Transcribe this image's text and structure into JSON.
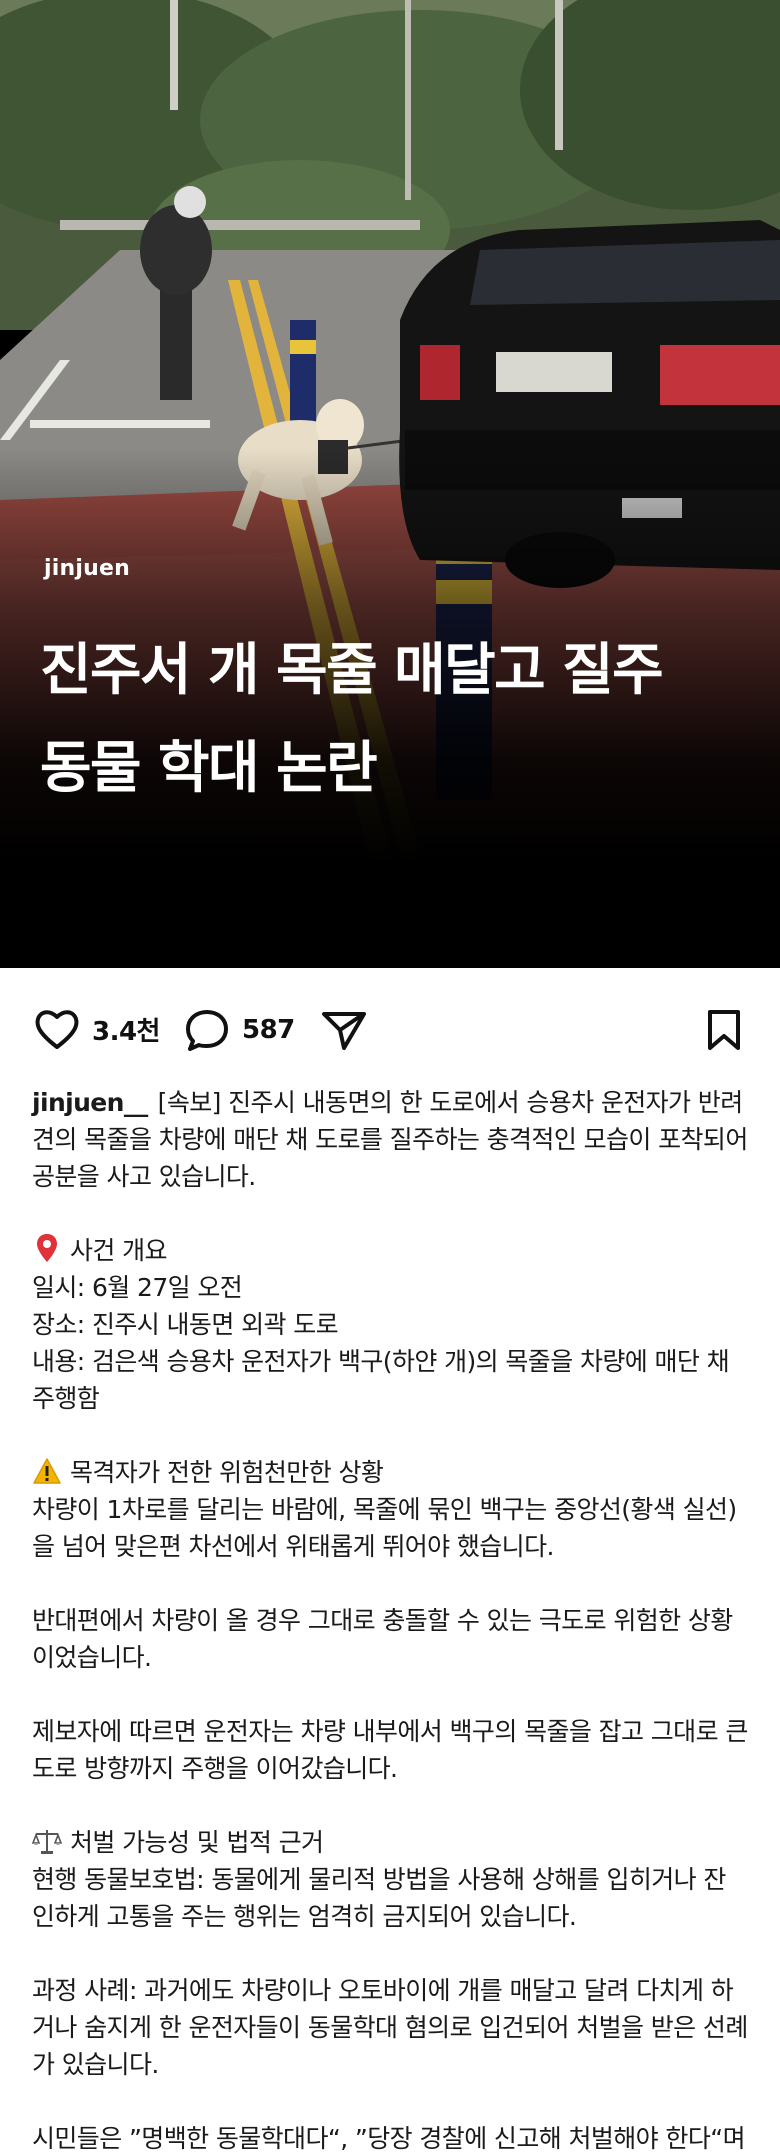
{
  "image": {
    "watermark": "jinjuen",
    "headline_lines": [
      "진주서 개 목줄 매달고 질주",
      "동물 학대 논란"
    ]
  },
  "actions": {
    "likes": "3.4천",
    "comments": "587",
    "icons": [
      "heart-icon",
      "comment-icon",
      "send-icon",
      "bookmark-icon"
    ]
  },
  "post": {
    "username": "jinjuen__",
    "intro": "[속보] 진주시 내동면의 한 도로에서 승용차 운전자가 반려견의 목줄을 차량에 매단 채 도로를 질주하는 충격적인 모습이 포착되어 공분을 사고 있습니다.",
    "overview": {
      "icon": "pin-icon",
      "heading": "사건 개요",
      "lines": [
        "일시: 6월 27일 오전",
        "장소: 진주시 내동면 외곽 도로",
        "내용: 검은색 승용차 운전자가 백구(하얀 개)의 목줄을 차량에 매단 채 주행함"
      ]
    },
    "witness": {
      "icon": "warning-icon",
      "heading": "목격자가 전한 위험천만한 상황",
      "paragraphs": [
        "차량이 1차로를 달리는 바람에, 목줄에 묶인 백구는 중앙선(황색 실선)을 넘어 맞은편 차선에서 위태롭게 뛰어야 했습니다.",
        "반대편에서 차량이 올 경우 그대로 충돌할 수 있는 극도로 위험한 상황이었습니다.",
        "제보자에 따르면 운전자는 차량 내부에서 백구의 목줄을 잡고 그대로 큰 도로 방향까지 주행을 이어갔습니다."
      ]
    },
    "legal": {
      "icon": "scales-icon",
      "heading": "처벌 가능성 및 법적 근거",
      "paragraphs": [
        "현행 동물보호법: 동물에게 물리적 방법을 사용해 상해를 입히거나 잔인하게 고통을 주는 행위는 엄격히 금지되어 있습니다.",
        "과정 사례: 과거에도 차량이나 오토바이에 개를 매달고 달려 다치게 하거나 숨지게 한 운전자들이 동물학대 혐의로 입건되어 처벌을 받은 선례가 있습니다.",
        "시민들은 ”명백한 동물학대다“, ”당장 경찰에 신고해 처벌해야 한다“며 강한 비판과 분통을 터뜨리고 있습니다"
      ]
    }
  }
}
